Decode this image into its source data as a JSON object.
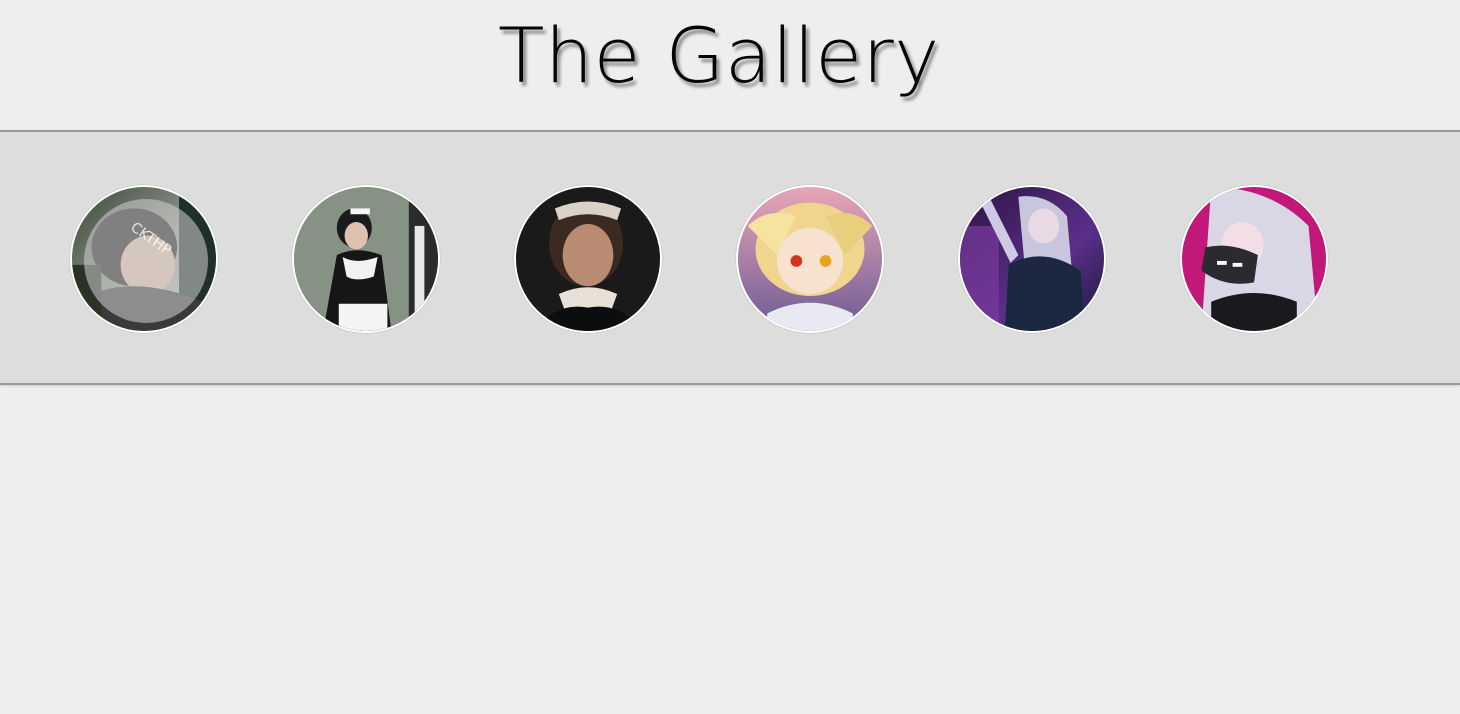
{
  "page": {
    "title": "The Gallery"
  },
  "gallery": {
    "items": [
      {
        "name": "portrait-girl-window",
        "state": "hover",
        "watermark": "CKTHP"
      },
      {
        "name": "maid-girl-photo",
        "state": "normal"
      },
      {
        "name": "maid-3d-render",
        "state": "normal"
      },
      {
        "name": "blonde-anime-girl",
        "state": "normal"
      },
      {
        "name": "silver-hair-purple-girl",
        "state": "normal"
      },
      {
        "name": "silver-hair-mask-girl",
        "state": "normal"
      }
    ]
  },
  "colors": {
    "background": "#eeeeee",
    "strip": "#dddddd",
    "strip_border": "#9a9a9a",
    "title": "#050505",
    "thumb_border": "#ffffff"
  }
}
